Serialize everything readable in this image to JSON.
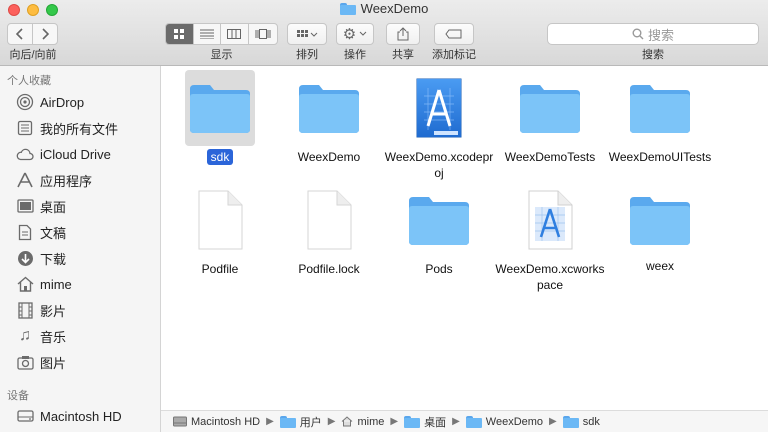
{
  "window": {
    "title": "WeexDemo"
  },
  "toolbar": {
    "nav_label": "向后/向前",
    "view_label": "显示",
    "arrange_label": "排列",
    "action_label": "操作",
    "share_label": "共享",
    "tags_label": "添加标记",
    "search_label": "搜索",
    "search_placeholder": "搜索"
  },
  "sidebar": {
    "favorites_header": "个人收藏",
    "favorites": [
      {
        "label": "AirDrop",
        "icon": "airdrop-icon"
      },
      {
        "label": "我的所有文件",
        "icon": "all-files-icon"
      },
      {
        "label": "iCloud Drive",
        "icon": "cloud-icon"
      },
      {
        "label": "应用程序",
        "icon": "applications-icon"
      },
      {
        "label": "桌面",
        "icon": "desktop-icon"
      },
      {
        "label": "文稿",
        "icon": "documents-icon"
      },
      {
        "label": "下载",
        "icon": "downloads-icon"
      },
      {
        "label": "mime",
        "icon": "home-icon"
      },
      {
        "label": "影片",
        "icon": "movies-icon"
      },
      {
        "label": "音乐",
        "icon": "music-icon"
      },
      {
        "label": "图片",
        "icon": "pictures-icon"
      }
    ],
    "devices_header": "设备",
    "devices": [
      {
        "label": "Macintosh HD",
        "icon": "harddisk-icon"
      }
    ]
  },
  "files": [
    {
      "name": "sdk",
      "type": "folder",
      "selected": true
    },
    {
      "name": "WeexDemo",
      "type": "folder"
    },
    {
      "name": "WeexDemo.xcodeproj",
      "type": "xcodeproj"
    },
    {
      "name": "WeexDemoTests",
      "type": "folder"
    },
    {
      "name": "WeexDemoUITests",
      "type": "folder"
    },
    {
      "name": "Podfile",
      "type": "document"
    },
    {
      "name": "Podfile.lock",
      "type": "document"
    },
    {
      "name": "Pods",
      "type": "folder"
    },
    {
      "name": "WeexDemo.xcworkspace",
      "type": "xcworkspace"
    },
    {
      "name": "weex",
      "type": "folder"
    }
  ],
  "pathbar": [
    "Macintosh HD",
    "用户",
    "mime",
    "桌面",
    "WeexDemo",
    "sdk"
  ],
  "colors": {
    "folder": "#6bb8f5",
    "selection": "#2b65d9",
    "close": "#fc605c",
    "minimize": "#fdbc40",
    "zoom": "#34c84a"
  }
}
